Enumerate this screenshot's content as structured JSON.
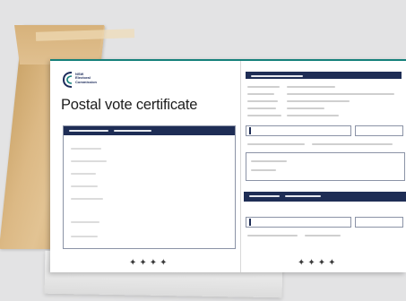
{
  "certificate": {
    "logo_text": "NSW\nElectoral\nCommission",
    "title": "Postal vote certificate",
    "signature_marks_left": "✦✦✦✦",
    "signature_marks_right": "✦✦✦✦"
  },
  "colors": {
    "background": "#e3e3e4",
    "envelope": "#dcb985",
    "navy": "#1e2d55",
    "teal_accent": "#14807a"
  }
}
